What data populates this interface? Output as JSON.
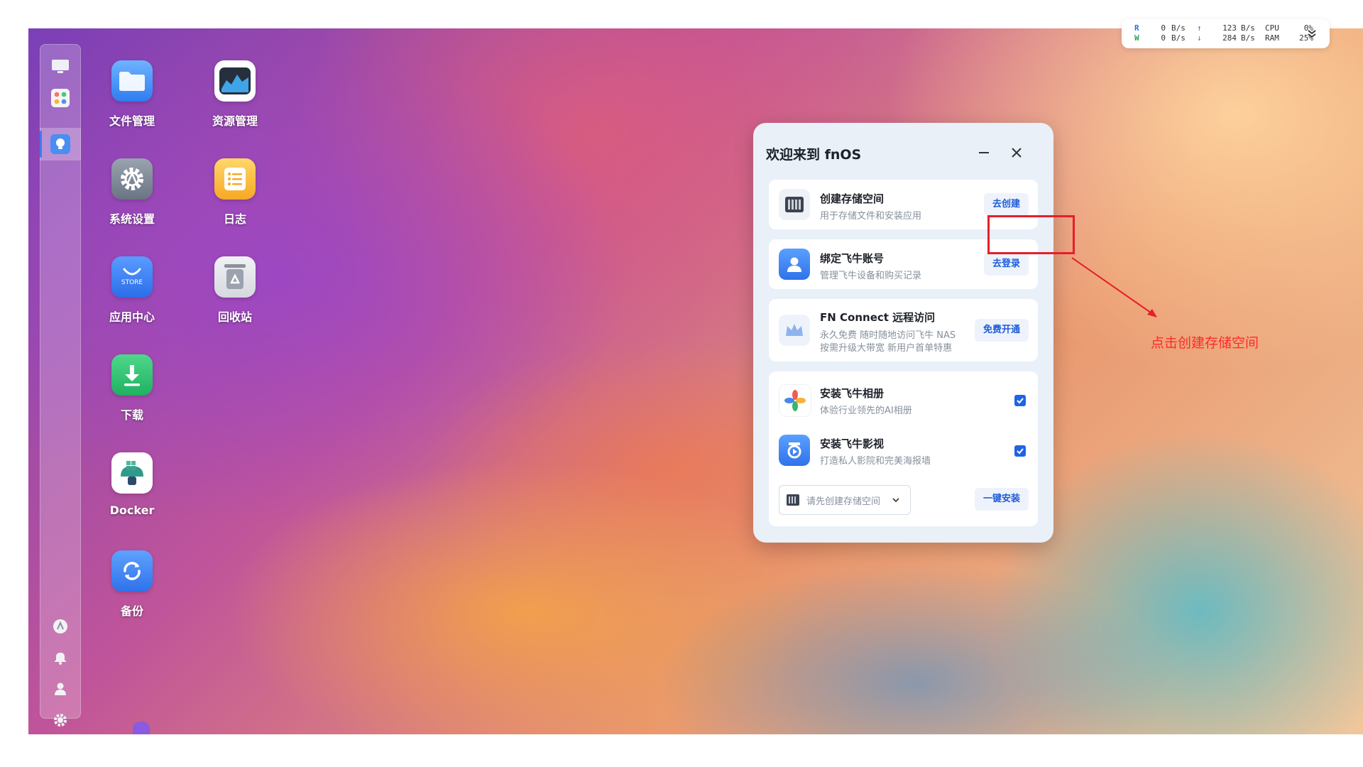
{
  "desktop": {
    "apps": [
      {
        "id": "files",
        "label": "文件管理",
        "icon": "folder-icon"
      },
      {
        "id": "resource",
        "label": "资源管理",
        "icon": "activity-monitor-icon"
      },
      {
        "id": "settings",
        "label": "系统设置",
        "icon": "gear-icon"
      },
      {
        "id": "logs",
        "label": "日志",
        "icon": "list-icon"
      },
      {
        "id": "store",
        "label": "应用中心",
        "icon": "store-bag-icon",
        "badge": "STORE"
      },
      {
        "id": "recycle",
        "label": "回收站",
        "icon": "recycle-icon"
      },
      {
        "id": "download",
        "label": "下载",
        "icon": "download-icon"
      },
      {
        "id": "docker",
        "label": "Docker",
        "icon": "docker-icon"
      },
      {
        "id": "backup",
        "label": "备份",
        "icon": "sync-icon"
      }
    ]
  },
  "dock": {
    "top_items": [
      "monitor-icon",
      "app-grid-icon",
      "tips-icon"
    ],
    "bottom_items": [
      "fn-logo-icon",
      "bell-icon",
      "user-icon",
      "settings-icon"
    ]
  },
  "monitor": {
    "read_label": "R",
    "write_label": "W",
    "read_value": "0",
    "write_value": "0",
    "unit": "B/s",
    "upload_value": "123",
    "download_value": "284",
    "cpu_label": "CPU",
    "ram_label": "RAM",
    "cpu_value": "0%",
    "ram_value": "25%"
  },
  "dialog": {
    "title": "欢迎来到 fnOS",
    "cards": {
      "storage": {
        "title": "创建存储空间",
        "subtitle": "用于存储文件和安装应用",
        "button": "去创建"
      },
      "account": {
        "title": "绑定飞牛账号",
        "subtitle": "管理飞牛设备和购买记录",
        "button": "去登录"
      },
      "connect": {
        "title": "FN Connect 远程访问",
        "subtitle_line1": "永久免费 随时随地访问飞牛 NAS",
        "subtitle_line2": "按需升级大带宽 新用户首单特惠",
        "button": "免费开通"
      }
    },
    "install": {
      "photos": {
        "title": "安装飞牛相册",
        "subtitle": "体验行业领先的AI相册",
        "checked": true
      },
      "video": {
        "title": "安装飞牛影视",
        "subtitle": "打造私人影院和完美海报墙",
        "checked": true
      },
      "select_placeholder": "请先创建存储空间",
      "install_button": "一键安装"
    }
  },
  "annotation": {
    "text": "点击创建存储空间",
    "color": "#e61e2a"
  },
  "colors": {
    "accent": "#1f63e6",
    "dialog_bg": "#e9f0f8"
  }
}
